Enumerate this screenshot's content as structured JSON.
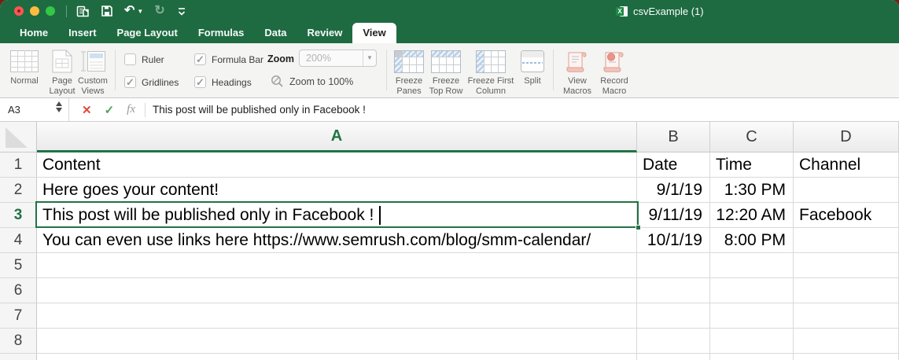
{
  "window": {
    "title": "csvExample (1)"
  },
  "tabs": [
    {
      "label": "Home",
      "active": false
    },
    {
      "label": "Insert",
      "active": false
    },
    {
      "label": "Page Layout",
      "active": false
    },
    {
      "label": "Formulas",
      "active": false
    },
    {
      "label": "Data",
      "active": false
    },
    {
      "label": "Review",
      "active": false
    },
    {
      "label": "View",
      "active": true
    }
  ],
  "ribbon": {
    "views": [
      {
        "label": "Normal"
      },
      {
        "label": "Page Layout"
      },
      {
        "label": "Custom Views"
      }
    ],
    "show": [
      {
        "label": "Ruler",
        "checked": false
      },
      {
        "label": "Gridlines",
        "checked": true
      },
      {
        "label": "Formula Bar",
        "checked": true
      },
      {
        "label": "Headings",
        "checked": true
      }
    ],
    "zoom": {
      "label": "Zoom",
      "value": "200%",
      "zoom_100": "Zoom to 100%"
    },
    "window_group": [
      {
        "label": "Freeze Panes"
      },
      {
        "label": "Freeze Top Row"
      },
      {
        "label": "Freeze First Column"
      },
      {
        "label": "Split"
      }
    ],
    "macros": [
      {
        "label": "View Macros"
      },
      {
        "label": "Record Macro"
      }
    ]
  },
  "formula_bar": {
    "cell_ref": "A3",
    "formula": "This post will be published only in Facebook !"
  },
  "sheet": {
    "active_cell": "A3",
    "columns": [
      "A",
      "B",
      "C",
      "D"
    ],
    "row_numbers": [
      "1",
      "2",
      "3",
      "4",
      "5",
      "6",
      "7",
      "8"
    ],
    "cells": [
      [
        "Content",
        "Date",
        "Time",
        "Channel"
      ],
      [
        "Here goes your content!",
        "9/1/19",
        "1:30 PM",
        ""
      ],
      [
        "This post will be published only in Facebook !",
        "9/11/19",
        "12:20 AM",
        "Facebook"
      ],
      [
        "You can even use links here https://www.semrush.com/blog/smm-calendar/",
        "10/1/19",
        "8:00 PM",
        ""
      ]
    ]
  },
  "colors": {
    "excel_green": "#1e6b41",
    "selection_green": "#217346"
  }
}
